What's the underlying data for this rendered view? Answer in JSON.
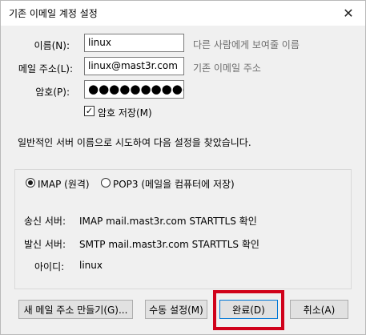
{
  "window": {
    "title": "기존 이메일 계정 설정",
    "close_icon": "close-icon"
  },
  "form": {
    "name_label": "이름(N):",
    "name_value": "linux",
    "name_hint": "다른 사람에게 보여줄 이름",
    "email_label": "메일 주소(L):",
    "email_value": "linux@mast3r.com",
    "email_hint": "기존 이메일 주소",
    "password_label": "암호(P):",
    "password_value": "●●●●●●●●●●●",
    "remember_label": "암호 저장(M)",
    "remember_checked": true
  },
  "message": "일반적인 서버 이름으로 시도하여 다음 설정을 찾았습니다.",
  "server": {
    "imap_label": "IMAP (원격)",
    "pop3_label": "POP3 (메일을 컴퓨터에 저장)",
    "selected": "IMAP",
    "outgoing_label": "송신 서버:",
    "outgoing_value": "IMAP mail.mast3r.com STARTTLS 확인",
    "incoming_label": "발신 서버:",
    "incoming_value": "SMTP mail.mast3r.com STARTTLS 확인",
    "id_label": "아이디:",
    "id_value": "linux"
  },
  "buttons": {
    "new_address": "새 메일 주소 만들기(G)...",
    "manual": "수동 설정(M)",
    "done": "완료(D)",
    "cancel": "취소(A)"
  },
  "colors": {
    "highlight": "#d0021b",
    "dialog_bg": "#f0f0f0"
  }
}
